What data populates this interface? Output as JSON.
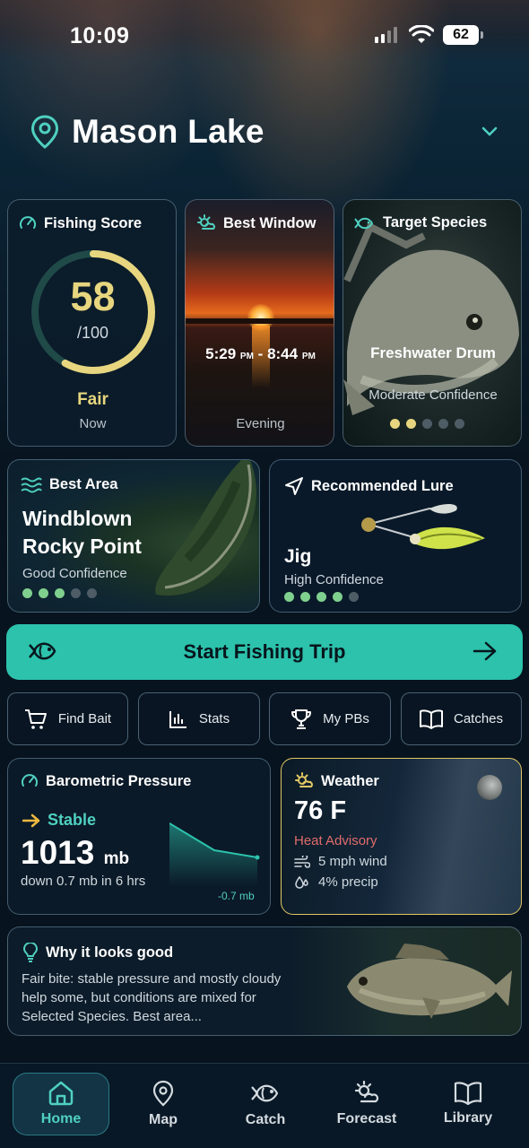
{
  "status_bar": {
    "time": "10:09",
    "battery": "62"
  },
  "header": {
    "lake_name": "Mason Lake",
    "pin_icon": "map-pin-icon",
    "chevron_icon": "chevron-down-icon"
  },
  "fishing_score": {
    "title": "Fishing Score",
    "value": "58",
    "max": "/100",
    "score_fraction": 0.58,
    "rating": "Fair",
    "when": "Now",
    "ring_color": "#e7d67f"
  },
  "best_window": {
    "title": "Best Window",
    "start": "5:29",
    "start_suffix": "PM",
    "end": "8:44",
    "end_suffix": "PM",
    "separator": "-",
    "when": "Evening"
  },
  "target_species": {
    "title": "Target Species",
    "name": "Freshwater Drum",
    "confidence": "Moderate Confidence",
    "dots_total": 5,
    "dots_active": 2
  },
  "best_area": {
    "title": "Best Area",
    "name": "Windblown Rocky Point",
    "confidence": "Good Confidence",
    "dots_total": 5,
    "dots_active": 3
  },
  "lure": {
    "title": "Recommended Lure",
    "name": "Jig",
    "confidence": "High Confidence",
    "dots_total": 5,
    "dots_active": 4
  },
  "cta": {
    "label": "Start Fishing Trip",
    "color": "#2cc2ac"
  },
  "quick_actions": [
    {
      "label": "Find Bait",
      "icon": "cart-icon"
    },
    {
      "label": "Stats",
      "icon": "bar-chart-icon"
    },
    {
      "label": "My PBs",
      "icon": "trophy-icon"
    },
    {
      "label": "Catches",
      "icon": "book-icon"
    }
  ],
  "pressure": {
    "title": "Barometric Pressure",
    "trend": "Stable",
    "value": "1013",
    "unit": "mb",
    "change": "down 0.7 mb in 6 hrs",
    "delta": "-0.7 mb"
  },
  "weather": {
    "title": "Weather",
    "temp": "76 F",
    "advisory": "Heat Advisory",
    "wind": "5 mph wind",
    "precip": "4% precip"
  },
  "why": {
    "title": "Why it looks good",
    "text": "Fair bite: stable pressure and mostly cloudy help some, but conditions are mixed for Selected Species. Best area..."
  },
  "nav": [
    {
      "label": "Home",
      "icon": "home-icon",
      "active": true
    },
    {
      "label": "Map",
      "icon": "map-pin-icon"
    },
    {
      "label": "Catch",
      "icon": "fish-icon"
    },
    {
      "label": "Forecast",
      "icon": "sun-cloud-icon"
    },
    {
      "label": "Library",
      "icon": "book-icon"
    }
  ]
}
